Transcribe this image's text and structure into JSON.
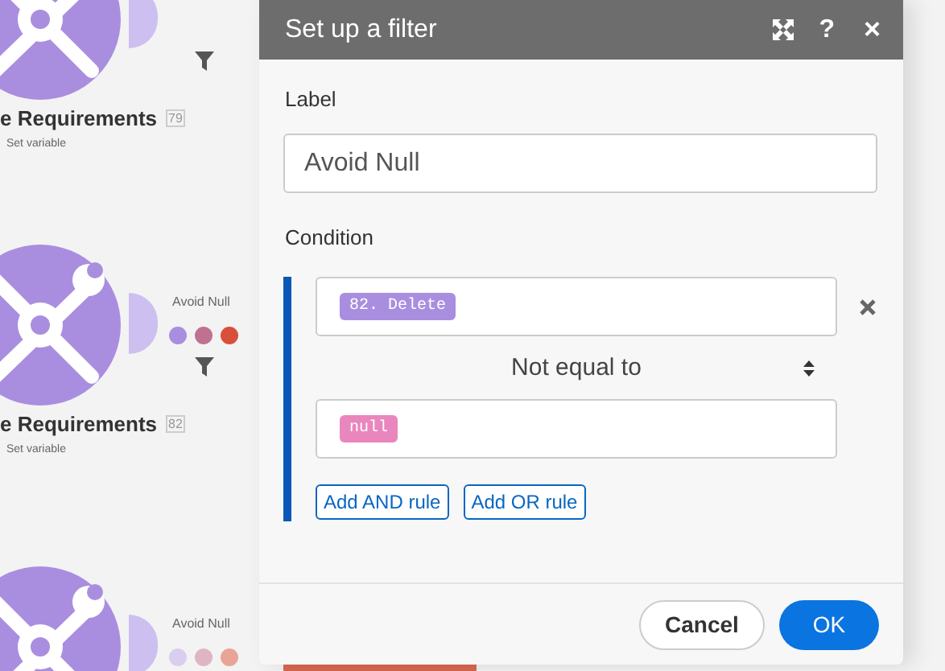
{
  "canvas": {
    "modules": [
      {
        "title": "e Requirements",
        "badge": "79",
        "subtitle": "Set variable"
      },
      {
        "title": "e Requirements",
        "badge": "82",
        "subtitle": "Set variable",
        "route": {
          "label": "Avoid Null",
          "dots": [
            {
              "color": "#a98ee0"
            },
            {
              "color": "#c0718f"
            },
            {
              "color": "#d9503a"
            }
          ]
        }
      },
      {
        "route": {
          "label": "Avoid Null",
          "dots": [
            {
              "color": "#d9cdf0"
            },
            {
              "color": "#e0b5c3"
            },
            {
              "color": "#e8a596"
            }
          ]
        }
      }
    ]
  },
  "dialog": {
    "title": "Set up a filter",
    "help": "?",
    "close": "×",
    "label_field": {
      "label": "Label",
      "value": "Avoid Null"
    },
    "condition": {
      "label": "Condition",
      "rules": [
        {
          "operand_1": "82. Delete",
          "operator": "Not equal to",
          "operand_2": "null"
        }
      ],
      "buttons": [
        "Add AND rule",
        "Add OR rule"
      ]
    },
    "footer": {
      "cancel": "Cancel",
      "ok": "OK"
    }
  }
}
